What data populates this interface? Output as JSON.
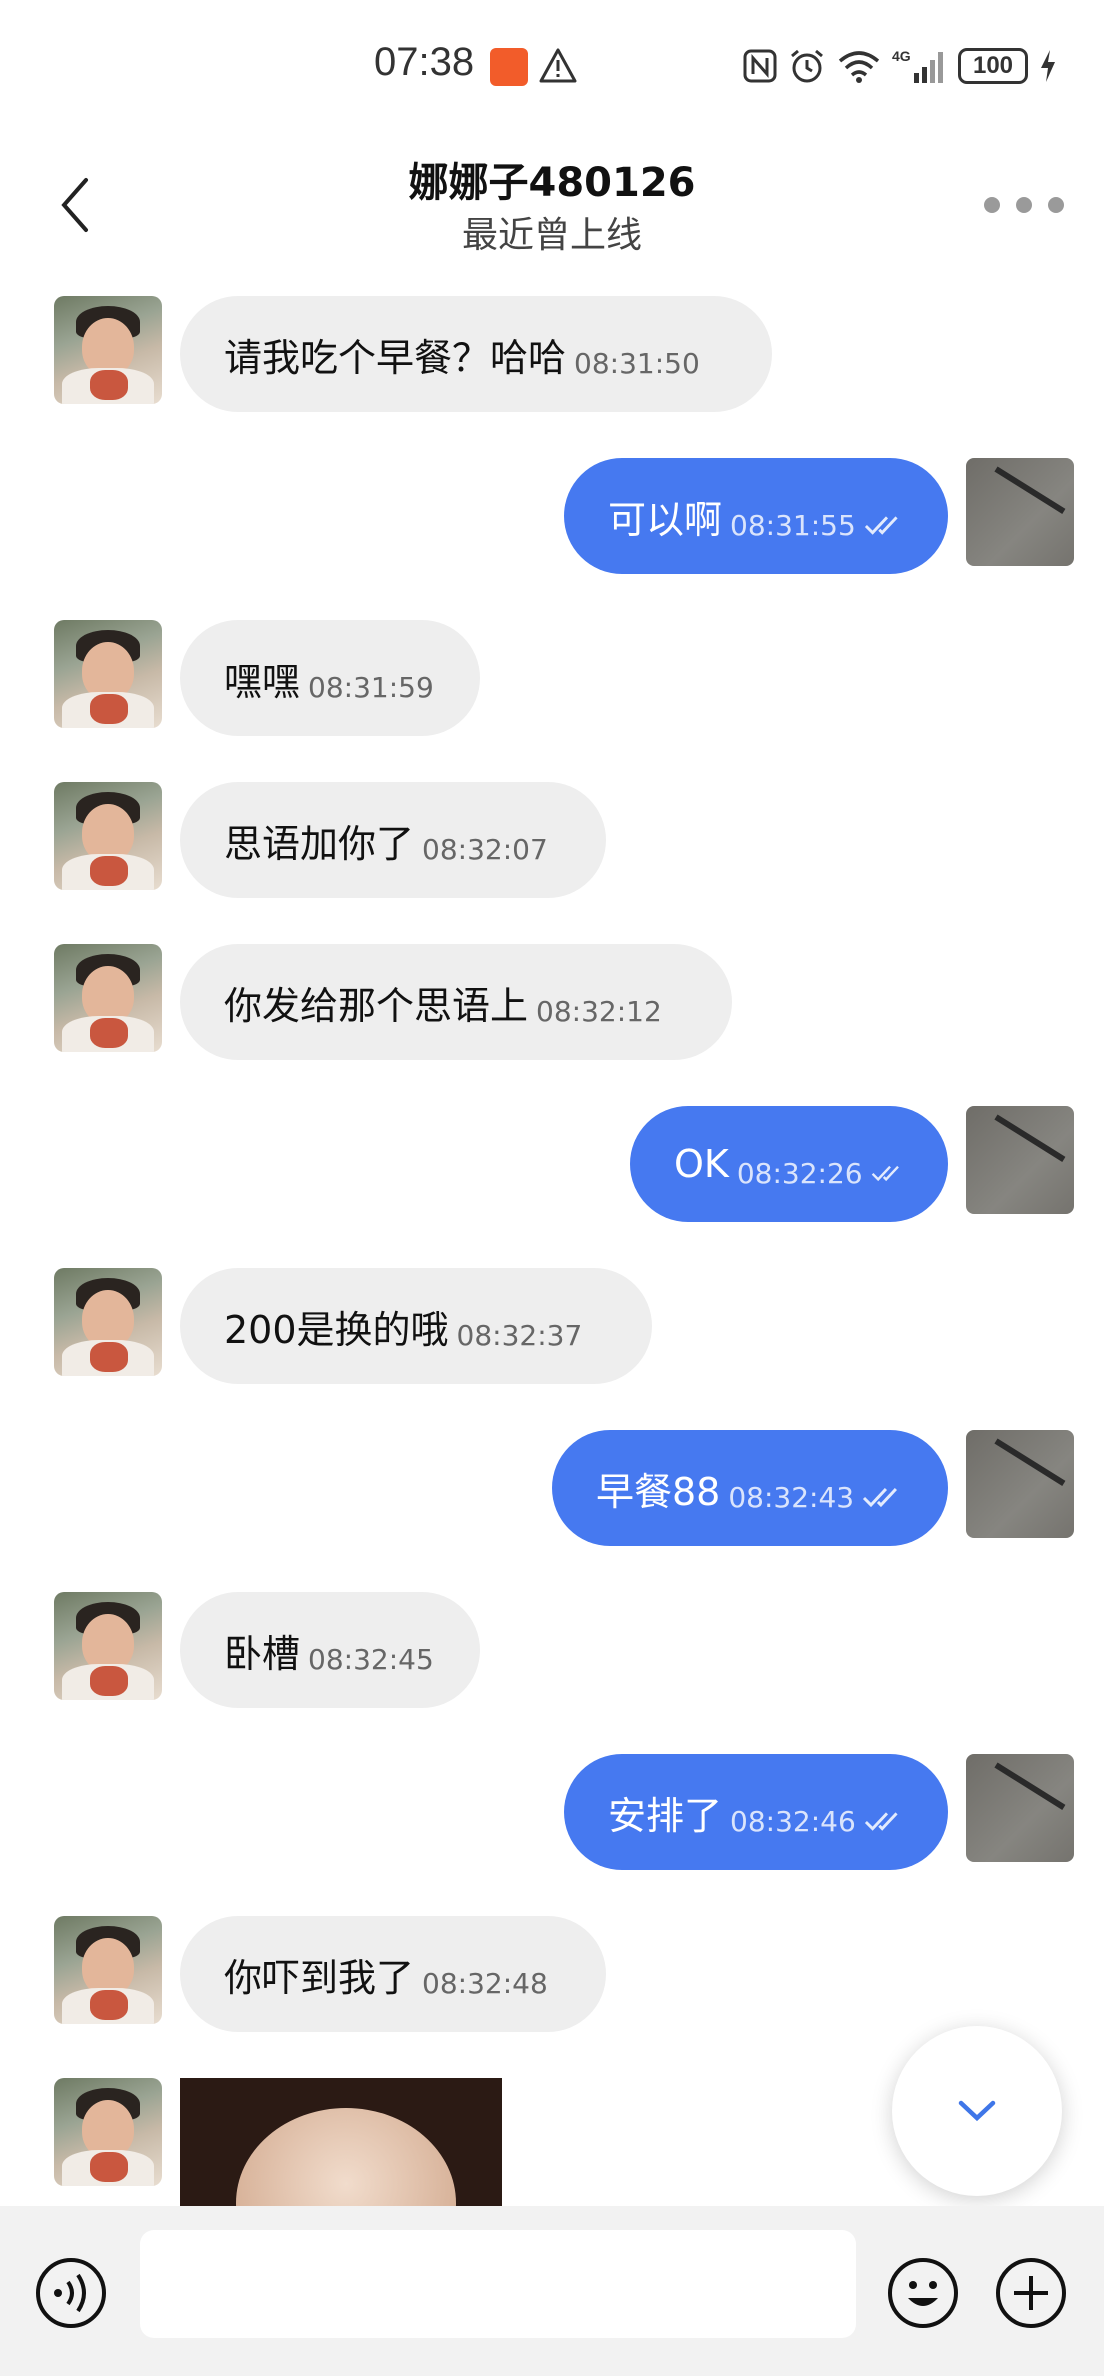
{
  "status_bar": {
    "time": "07:38",
    "battery": "100"
  },
  "header": {
    "name": "娜娜子480126",
    "status": "最近曾上线"
  },
  "messages": [
    {
      "dir": "in",
      "text": "请我吃个早餐？哈哈",
      "time": "08:31:50"
    },
    {
      "dir": "out",
      "text": "可以啊",
      "time": "08:31:55"
    },
    {
      "dir": "in",
      "text": "嘿嘿",
      "time": "08:31:59"
    },
    {
      "dir": "in",
      "text": "思语加你了",
      "time": "08:32:07"
    },
    {
      "dir": "in",
      "text": "你发给那个思语上",
      "time": "08:32:12"
    },
    {
      "dir": "out",
      "text": "OK",
      "time": "08:32:26"
    },
    {
      "dir": "in",
      "text": "200是换的哦",
      "time": "08:32:37"
    },
    {
      "dir": "out",
      "text": "早餐88",
      "time": "08:32:43"
    },
    {
      "dir": "in",
      "text": "卧槽",
      "time": "08:32:45"
    },
    {
      "dir": "out",
      "text": "安排了",
      "time": "08:32:46"
    },
    {
      "dir": "in",
      "text": "你吓到我了",
      "time": "08:32:48"
    }
  ],
  "composer": {
    "placeholder": ""
  },
  "colors": {
    "outgoing_bubble": "#4679f0",
    "incoming_bubble": "#eeeeee",
    "composer_bg": "#f2f2f2"
  },
  "icons": [
    "back-arrow-icon",
    "more-dots-icon",
    "read-ticks-icon",
    "chevron-down-icon",
    "voice-icon",
    "emoji-icon",
    "plus-icon"
  ]
}
